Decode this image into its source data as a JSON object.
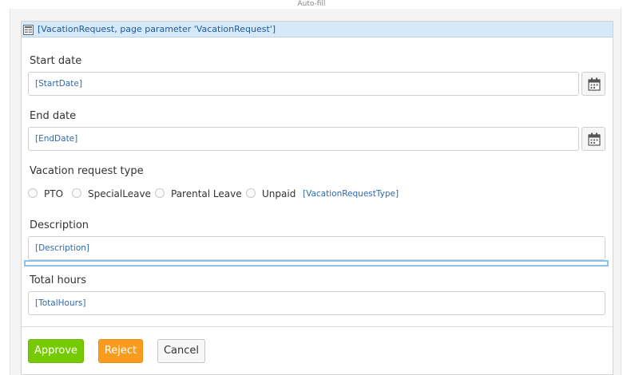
{
  "window": {
    "tab_label": "Auto-fill"
  },
  "dataview": {
    "header_title": "[VacationRequest, page parameter 'VacationRequest']"
  },
  "fields": {
    "start_date": {
      "label": "Start date",
      "value": "[StartDate]"
    },
    "end_date": {
      "label": "End date",
      "value": "[EndDate]"
    },
    "vacation_type": {
      "label": "Vacation request type",
      "options": [
        "PTO",
        "SpecialLeave",
        "Parental Leave",
        "Unpaid"
      ],
      "binding": "[VacationRequestType]"
    },
    "description": {
      "label": "Description",
      "value": "[Description]"
    },
    "total_hours": {
      "label": "Total hours",
      "value": "[TotalHours]"
    }
  },
  "buttons": {
    "approve": "Approve",
    "reject": "Reject",
    "cancel": "Cancel"
  },
  "colors": {
    "header_bg": "#d6e9f8",
    "binding_text": "#2e69b0",
    "approve": "#76ca02",
    "reject": "#f99b1d",
    "drop_indicator": "#8ec2ea"
  },
  "icons": {
    "header": "dataview-icon",
    "date_picker": "calendar-icon"
  }
}
